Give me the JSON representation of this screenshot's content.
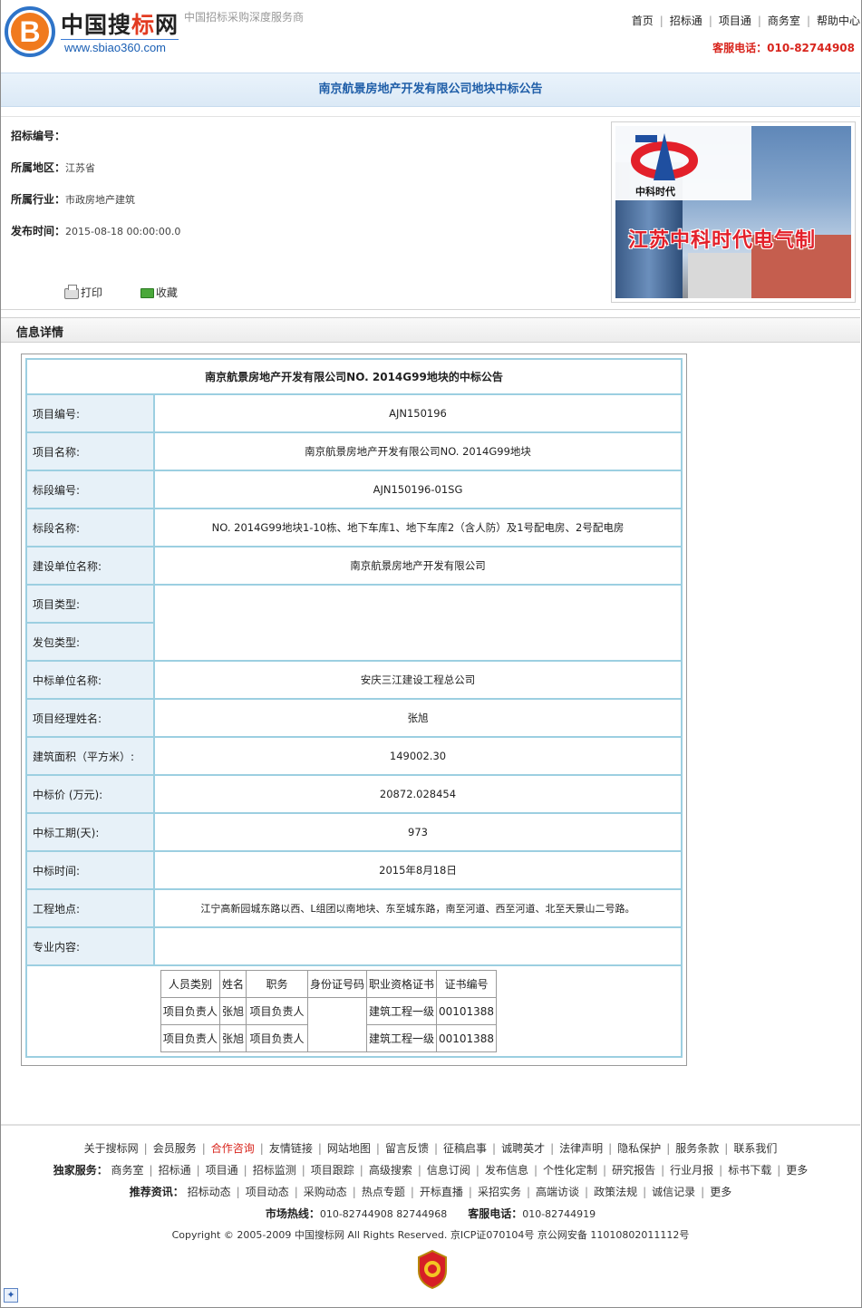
{
  "header": {
    "logo_letter": "B",
    "logo_title_prefix": "中国搜",
    "logo_title_red": "标",
    "logo_title_suffix": "网",
    "logo_url": "www.sbiao360.com",
    "slogan": "中国招标采购深度服务商",
    "nav": [
      "首页",
      "招标通",
      "项目通",
      "商务室",
      "帮助中心"
    ],
    "hotline": "客服电话：010-82744908"
  },
  "title": "南京航景房地产开发有限公司地块中标公告",
  "info": {
    "bid_no_label": "招标编号：",
    "bid_no": "",
    "region_label": "所属地区：",
    "region": "江苏省",
    "industry_label": "所属行业：",
    "industry": "市政房地产建筑",
    "time_label": "发布时间：",
    "time": "2015-08-18 00:00:00.0",
    "print_label": "打印",
    "fav_label": "收藏"
  },
  "ad": {
    "brand": "中科时代",
    "slogan": "江苏中科时代电气制"
  },
  "section_title": "信息详情",
  "detail": {
    "heading": "南京航景房地产开发有限公司NO. 2014G99地块的中标公告",
    "rows": [
      {
        "k": "项目编号:",
        "v": "AJN150196"
      },
      {
        "k": "项目名称:",
        "v": "南京航景房地产开发有限公司NO. 2014G99地块"
      },
      {
        "k": "标段编号:",
        "v": "AJN150196-01SG"
      },
      {
        "k": "标段名称:",
        "v": "NO. 2014G99地块1-10栋、地下车库1、地下车库2（含人防）及1号配电房、2号配电房"
      },
      {
        "k": "建设单位名称:",
        "v": "南京航景房地产开发有限公司"
      },
      {
        "k": "项目类型:",
        "v": ""
      },
      {
        "k": "发包类型:",
        "v": ""
      },
      {
        "k": "中标单位名称:",
        "v": "安庆三江建设工程总公司"
      },
      {
        "k": "项目经理姓名:",
        "v": "张旭"
      },
      {
        "k": "建筑面积（平方米）:",
        "v": "149002.30"
      },
      {
        "k": "中标价 (万元):",
        "v": "20872.028454"
      },
      {
        "k": "中标工期(天):",
        "v": "973"
      },
      {
        "k": "中标时间:",
        "v": "2015年8月18日"
      },
      {
        "k": "工程地点:",
        "v": "江宁高新园城东路以西、L组团以南地块、东至城东路，南至河道、西至河道、北至天景山二号路。"
      },
      {
        "k": "专业内容:",
        "v": ""
      }
    ],
    "personnel": {
      "headers": [
        "人员类别",
        "姓名",
        "职务",
        "身份证号码",
        "职业资格证书",
        "证书编号"
      ],
      "rows": [
        [
          "项目负责人",
          "张旭",
          "项目负责人",
          "",
          "建筑工程一级",
          "00101388"
        ],
        [
          "项目负责人",
          "张旭",
          "项目负责人",
          "",
          "建筑工程一级",
          "00101388"
        ]
      ]
    }
  },
  "footer": {
    "links1": [
      "关于搜标网",
      "会员服务",
      "合作咨询",
      "友情链接",
      "网站地图",
      "留言反馈",
      "征稿启事",
      "诚聘英才",
      "法律声明",
      "隐私保护",
      "服务条款",
      "联系我们"
    ],
    "exclusive_label": "独家服务：",
    "links2": [
      "商务室",
      "招标通",
      "项目通",
      "招标监测",
      "项目跟踪",
      "高级搜索",
      "信息订阅",
      "发布信息",
      "个性化定制",
      "研究报告",
      "行业月报",
      "标书下载",
      "更多"
    ],
    "recommend_label": "推荐资讯：",
    "links3": [
      "招标动态",
      "项目动态",
      "采购动态",
      "热点专题",
      "开标直播",
      "采招实务",
      "高端访谈",
      "政策法规",
      "诚信记录",
      "更多"
    ],
    "market_label": "市场热线：",
    "market_phone": "010-82744908 82744968",
    "service_label": "客服电话：",
    "service_phone": "010-82744919",
    "copyright": "Copyright © 2005-2009 中国搜标网 All Rights Reserved. 京ICP证070104号 京公网安备 11010802011112号"
  }
}
